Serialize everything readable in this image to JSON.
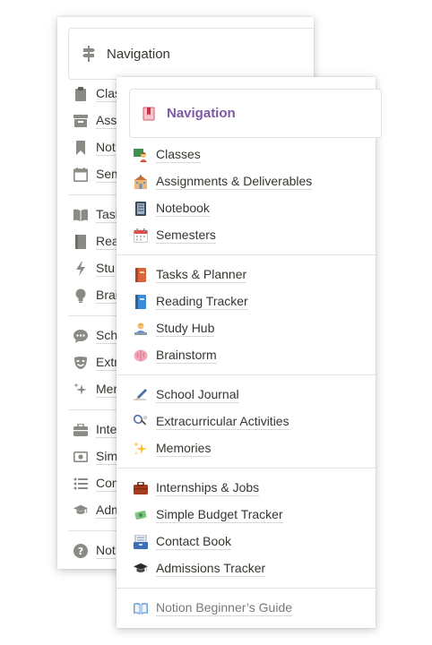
{
  "back_panel": {
    "header": {
      "title": "Navigation",
      "icon": "signpost-icon"
    },
    "groups": [
      [
        {
          "label": "Clas",
          "icon": "clipboard-icon"
        },
        {
          "label": "Assi",
          "icon": "archive-box-icon"
        },
        {
          "label": "Not",
          "icon": "bookmark-icon"
        },
        {
          "label": "Sem",
          "icon": "calendar-icon"
        }
      ],
      [
        {
          "label": "Task",
          "icon": "open-book-icon"
        },
        {
          "label": "Rea",
          "icon": "book-icon"
        },
        {
          "label": "Stu",
          "icon": "lightning-icon"
        },
        {
          "label": "Brai",
          "icon": "lightbulb-icon"
        }
      ],
      [
        {
          "label": "Scho",
          "icon": "speech-bubble-icon"
        },
        {
          "label": "Extr",
          "icon": "drama-mask-icon"
        },
        {
          "label": "Mer",
          "icon": "sparkles-icon"
        }
      ],
      [
        {
          "label": "Inte",
          "icon": "briefcase-icon"
        },
        {
          "label": "Sim",
          "icon": "banknote-icon"
        },
        {
          "label": "Con",
          "icon": "bullet-list-icon"
        },
        {
          "label": "Adm",
          "icon": "graduation-cap-icon"
        }
      ],
      [
        {
          "label": "Not",
          "icon": "question-mark-icon"
        }
      ]
    ]
  },
  "front_panel": {
    "header": {
      "title": "Navigation",
      "icon": "bookmark-ribbon-icon"
    },
    "groups": [
      [
        {
          "label": "Classes",
          "icon": "teacher-icon"
        },
        {
          "label": "Assignments & Deliverables",
          "icon": "school-building-icon"
        },
        {
          "label": "Notebook",
          "icon": "notebook-icon"
        },
        {
          "label": "Semesters",
          "icon": "calendar-icon"
        }
      ],
      [
        {
          "label": "Tasks & Planner",
          "icon": "red-book-icon"
        },
        {
          "label": "Reading Tracker",
          "icon": "blue-book-icon"
        },
        {
          "label": "Study Hub",
          "icon": "student-at-laptop-icon"
        },
        {
          "label": "Brainstorm",
          "icon": "brain-icon"
        }
      ],
      [
        {
          "label": "School Journal",
          "icon": "pen-writing-icon"
        },
        {
          "label": "Extracurricular Activities",
          "icon": "badminton-icon"
        },
        {
          "label": "Memories",
          "icon": "sparkles-icon"
        }
      ],
      [
        {
          "label": "Internships & Jobs",
          "icon": "briefcase-icon"
        },
        {
          "label": "Simple Budget Tracker",
          "icon": "money-with-wings-icon"
        },
        {
          "label": "Contact Book",
          "icon": "card-index-icon"
        },
        {
          "label": "Admissions Tracker",
          "icon": "graduation-cap-icon"
        }
      ],
      [
        {
          "label": "Notion Beginner’s Guide",
          "icon": "open-book-icon",
          "muted": true
        }
      ]
    ]
  }
}
